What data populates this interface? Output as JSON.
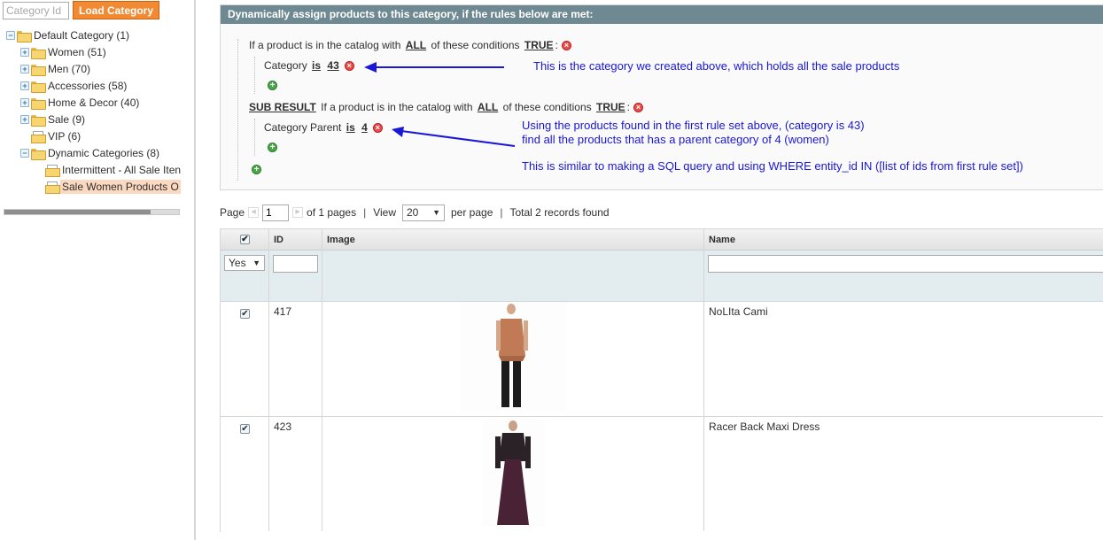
{
  "sidebar": {
    "category_id_placeholder": "Category Id",
    "load_button": "Load Category",
    "tree": [
      {
        "label": "Default Category (1)",
        "level": 0,
        "expander": "−",
        "icon": "folder-open-icon"
      },
      {
        "label": "Women (51)",
        "level": 1,
        "expander": "+",
        "icon": "folder-icon"
      },
      {
        "label": "Men (70)",
        "level": 1,
        "expander": "+",
        "icon": "folder-icon"
      },
      {
        "label": "Accessories (58)",
        "level": 1,
        "expander": "+",
        "icon": "folder-icon"
      },
      {
        "label": "Home & Decor (40)",
        "level": 1,
        "expander": "+",
        "icon": "folder-icon"
      },
      {
        "label": "Sale (9)",
        "level": 1,
        "expander": "+",
        "icon": "folder-icon"
      },
      {
        "label": "VIP (6)",
        "level": 1,
        "expander": "",
        "icon": "folder-doc-icon"
      },
      {
        "label": "Dynamic Categories (8)",
        "level": 1,
        "expander": "−",
        "icon": "folder-open-icon"
      },
      {
        "label": "Intermittent - All Sale Iten",
        "level": 2,
        "expander": "",
        "icon": "folder-doc-icon"
      },
      {
        "label": "Sale Women Products O",
        "level": 2,
        "expander": "",
        "icon": "folder-doc-icon",
        "selected": true
      }
    ]
  },
  "rules": {
    "header": "Dynamically assign products to this category, if the rules below are met:",
    "rule1": {
      "prefix": "If a product is in the catalog with",
      "aggregator": "ALL",
      "middle": "of these conditions",
      "value": "TRUE",
      "suffix": ":"
    },
    "cond1": {
      "attribute": "Category",
      "operator": "is",
      "value": "43"
    },
    "sub": {
      "title": "SUB RESULT",
      "prefix": "If a product is in the catalog with",
      "aggregator": "ALL",
      "middle": "of these conditions",
      "value": "TRUE",
      "suffix": ":"
    },
    "cond2": {
      "attribute": "Category Parent",
      "operator": "is",
      "value": "4"
    }
  },
  "annotations": {
    "a1": "This is the category we created above, which holds all the sale products",
    "a2": "Using the products found in the first rule set above, (category is 43)",
    "a3": "find all the products that has a parent category of 4 (women)",
    "a4": "This is similar to making a SQL query and using WHERE entity_id IN ([list of ids from first rule set])"
  },
  "pager": {
    "page_label": "Page",
    "page_value": "1",
    "of_pages": "of 1 pages",
    "sep": "|",
    "view_label": "View",
    "view_value": "20",
    "per_page": "per page",
    "total": "Total 2 records found"
  },
  "grid": {
    "headers": {
      "check": "✔",
      "id": "ID",
      "image": "Image",
      "name": "Name"
    },
    "filter": {
      "in_category": "Yes"
    },
    "rows": [
      {
        "checked": "✔",
        "id": "417",
        "name": "NoLIta Cami",
        "image_icon": "product-photo-cami-icon",
        "colors": {
          "top": "#c07a55",
          "bottom": "#1c1c1c"
        }
      },
      {
        "checked": "✔",
        "id": "423",
        "name": "Racer Back Maxi Dress",
        "image_icon": "product-photo-dress-icon",
        "colors": {
          "top": "#2a2226",
          "bottom": "#4a2235"
        }
      }
    ]
  },
  "colors": {
    "header_bg": "#6f8992",
    "button_orange": "#f18a33",
    "annotation_blue": "#1a17d6",
    "filter_bg": "#e3ecef"
  }
}
